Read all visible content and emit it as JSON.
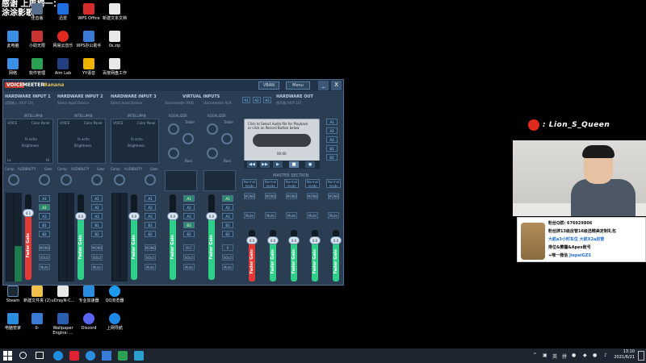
{
  "overlay": {
    "line1": "感谢 上周榜一：",
    "line2": "涂涂影歌"
  },
  "desktop_icons": [
    {
      "label": "佳音版",
      "color": "#5a6f8c"
    },
    {
      "label": "迅雷",
      "color": "#1e6fe0"
    },
    {
      "label": "WPS Office",
      "color": "#d62b2b"
    },
    {
      "label": "新建文本文档",
      "color": "#e8e8e8"
    },
    {
      "label": "此电脑",
      "color": "#3d8ee6"
    },
    {
      "label": "小助无限",
      "color": "#c33"
    },
    {
      "label": "网易云音乐",
      "color": "#e0291f"
    },
    {
      "label": "WPS办公助手",
      "color": "#3a7bd5"
    },
    {
      "label": "0s.zip",
      "color": "#e8e8e8"
    },
    {
      "label": "网络",
      "color": "#3d8ee6"
    },
    {
      "label": "软件管理",
      "color": "#2aa052"
    },
    {
      "label": "Aim Lab",
      "color": "#243f80"
    },
    {
      "label": "YY语音",
      "color": "#f0b400"
    },
    {
      "label": "百度网盘工作",
      "color": "#e8e8e8"
    },
    {
      "label": "Steam",
      "color": "#1b2838"
    },
    {
      "label": "新建文件夹 (2)",
      "color": "#f0c24a"
    },
    {
      "label": "uDrayN-C...",
      "color": "#e8e8e8"
    },
    {
      "label": "专业加速器",
      "color": "#2a8de0"
    },
    {
      "label": "QQ浏览器",
      "color": "#1d9bf0"
    },
    {
      "label": "电脑管家",
      "color": "#2a8de0"
    },
    {
      "label": "0-",
      "color": "#3a7bd5"
    },
    {
      "label": "Wallpaper Engine: ...",
      "color": "#2a5fb0"
    },
    {
      "label": "Discord",
      "color": "#5865f2"
    },
    {
      "label": "上网导航",
      "color": "#1e88e5"
    }
  ],
  "vm": {
    "brand_voice": "VOICE",
    "brand_meeter": "MEETER",
    "brand_banana": "Banana",
    "vban": "VBAN",
    "menu": "Menu",
    "minimize": "_",
    "close": "X",
    "hw1_title": "HARDWARE INPUT 1",
    "hw1_sub": "话筒输入 (HUY 10)",
    "hw2_title": "HARDWARE INPUT 2",
    "hw2_sub": "Select Input Device",
    "hw3_title": "HARDWARE INPUT 3",
    "hw3_sub": "Select Input Device",
    "virtual_title": "VIRTUAL INPUTS",
    "virtual_sub1": "Voicemeeter VAIO",
    "virtual_sub2": "Voicemeeter AUX",
    "hw_out_title": "HARDWARE OUT",
    "hw_out_sub": "扬声器 (HUY 10)",
    "a1": "A1",
    "a2": "A2",
    "a3": "A3",
    "intellipan": "INTELLIPAN",
    "voice": "VOICE",
    "color_panel": "Color Panel",
    "fx_echo": "fx echo",
    "brightness": "Brightness",
    "lo": "Lo",
    "hi": "Hi",
    "comp": "Comp",
    "audibility": "AUDIBILITY",
    "gate": "Gate",
    "equalizer": "EQUALIZER",
    "treble": "Treble",
    "bass": "Bass",
    "fader_gain": "Fader Gain",
    "fader_values": [
      "4.1",
      "0.0",
      "0.0",
      "0.0",
      "0.0"
    ],
    "bus_labels": [
      "A1",
      "A2",
      "A3",
      "B1",
      "B2"
    ],
    "mono": "MONO",
    "solo": "SOLO",
    "mute": "Mute",
    "mc": "M.C",
    "k": "K",
    "tape_line1": "Click to Select Audio file for Playback",
    "tape_line2": "or click on Record Button below",
    "tape_time": "00:00",
    "master_section": "MASTER SECTION",
    "normal_mode": "Normal mode",
    "master_values": [
      "0.0",
      "0.0",
      "0.0",
      "0.0",
      "0.0",
      "0.0"
    ],
    "master_bus_labels": [
      "A1",
      "A2",
      "A3",
      "B1",
      "B2"
    ]
  },
  "stream": {
    "username": ": Lion_S_Queen"
  },
  "promo": {
    "line1": "粉丝Q群: 676929806",
    "line2": "粉丝牌13级房管16级选精美定制礼包",
    "line3": "大航a3小时车位 大航X2a房管",
    "line4": "排位&雾霾&Apex账号",
    "line5": "+唯一微信",
    "wechat": "JiepaiGZS"
  },
  "taskbar": {
    "time": "13:10",
    "date": "2021/6/21",
    "lang": "英",
    "ime": "拼"
  }
}
